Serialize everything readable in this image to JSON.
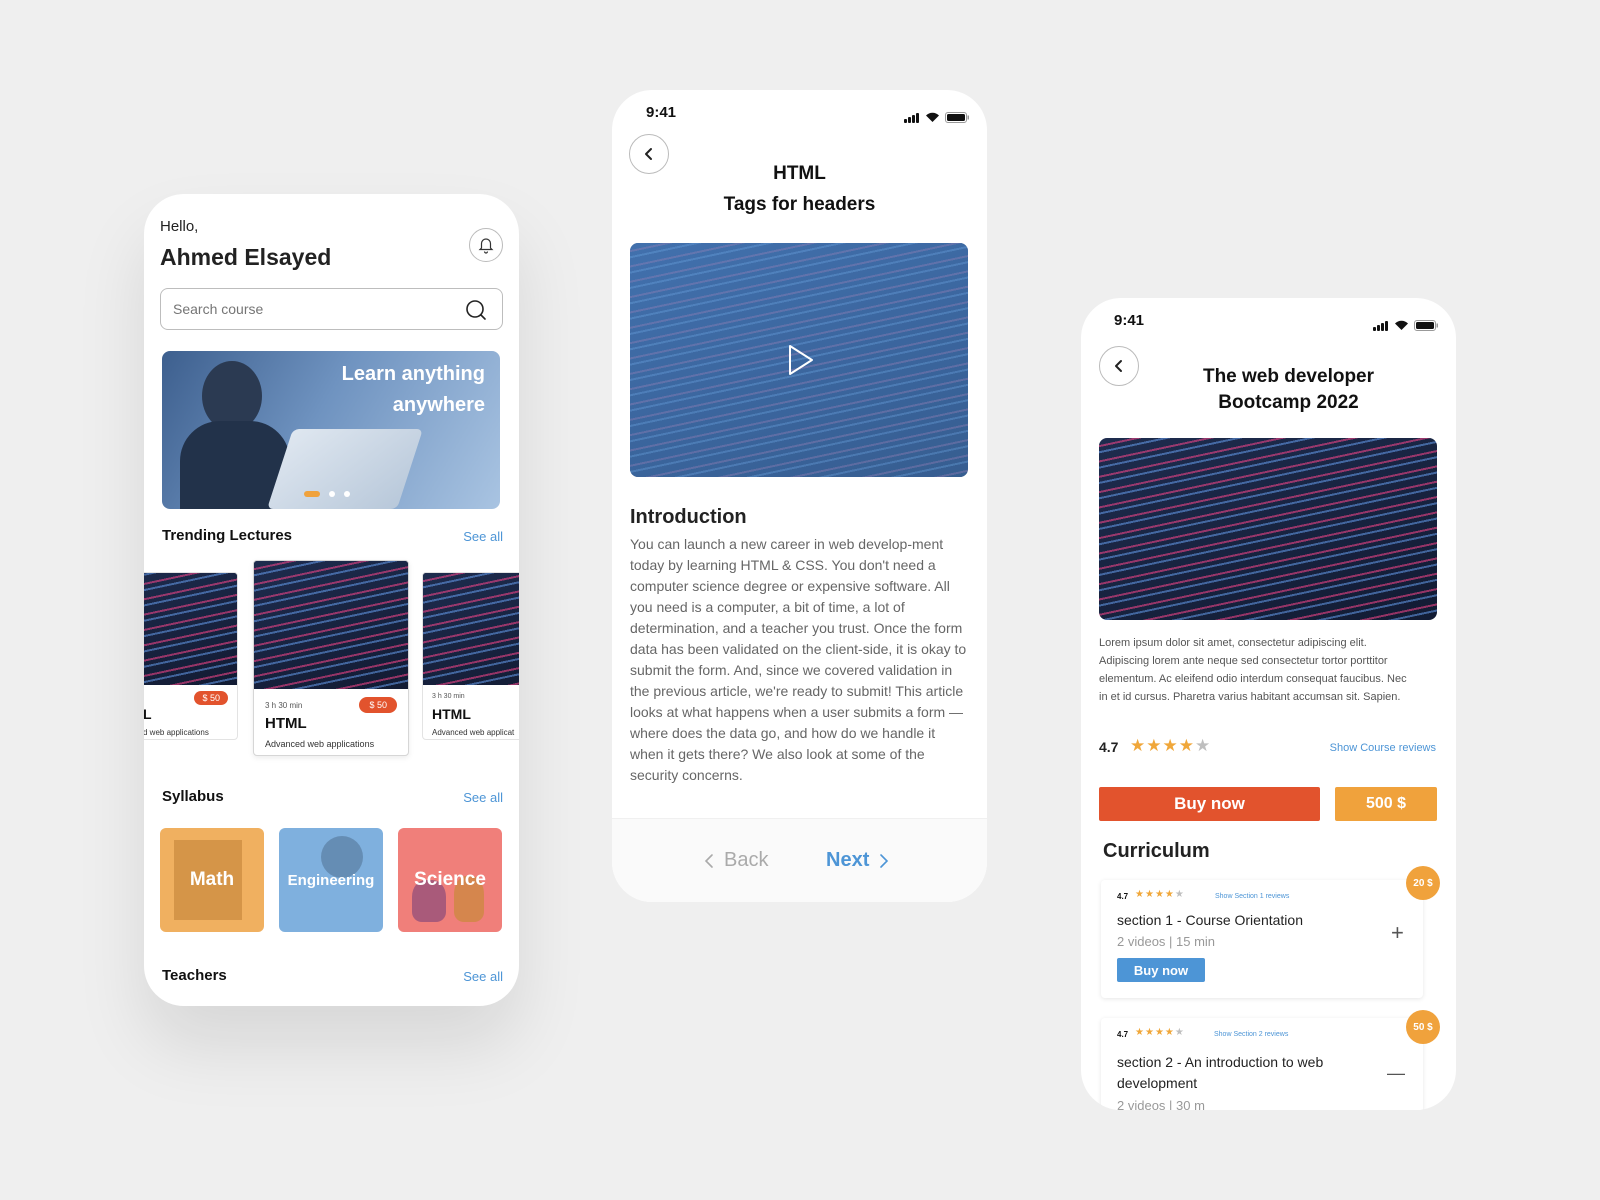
{
  "screen1": {
    "greeting": "Hello,",
    "user_name": "Ahmed Elsayed",
    "icons": {
      "notification": "bell-icon",
      "search": "search-icon"
    },
    "search": {
      "placeholder": "Search course"
    },
    "banner": {
      "line1": "Learn anything",
      "line2": "anywhere",
      "slide_count": 3,
      "active_slide": 1
    },
    "trending": {
      "title": "Trending Lectures",
      "see_all": "See all",
      "cards": [
        {
          "duration": "",
          "price": "$ 50",
          "title": "L",
          "subtitle": "d web applications"
        },
        {
          "duration": "3 h 30 min",
          "price": "$ 50",
          "title": "HTML",
          "subtitle": "Advanced web applications"
        },
        {
          "duration": "3 h 30 min",
          "price": "",
          "title": "HTML",
          "subtitle": "Advanced web applicat"
        }
      ]
    },
    "syllabus": {
      "title": "Syllabus",
      "see_all": "See all",
      "items": [
        {
          "label": "Math",
          "color": "#f0b060"
        },
        {
          "label": "Engineering",
          "color": "#7fb0de"
        },
        {
          "label": "Science",
          "color": "#f07f7a"
        }
      ]
    },
    "teachers": {
      "title": "Teachers",
      "see_all": "See all"
    }
  },
  "screen2": {
    "time": "9:41",
    "title_line1": "HTML",
    "title_line2": "Tags for headers",
    "icons": {
      "back": "chevron-left-icon",
      "play": "play-icon"
    },
    "intro_heading": "Introduction",
    "intro_text": "You can launch a new career in web develop-ment today by learning HTML & CSS. You don't need a computer science degree or expensive software. All you need is a computer, a bit of time, a lot of determination, and a teacher you trust. Once the form data has been validated on the client-side, it is okay to submit the form. And, since we covered validation in the previous article, we're ready to submit! This article looks at what happens when a user submits a form — where does the data go, and how do we handle it when it gets there? We also look at some of the security concerns.",
    "back_label": "Back",
    "next_label": "Next"
  },
  "screen3": {
    "time": "9:41",
    "title_line1": "The web developer",
    "title_line2": "Bootcamp 2022",
    "description": "Lorem ipsum dolor sit amet, consectetur adipiscing elit. Adipiscing lorem ante neque sed consectetur tortor porttitor elementum. Ac eleifend odio interdum consequat faucibus. Nec in et id cursus. Pharetra varius habitant accumsan sit. Sapien.",
    "rating": "4.7",
    "stars": 4,
    "reviews_link": "Show Course reviews",
    "buy_label": "Buy now",
    "price": "500 $",
    "curriculum_title": "Curriculum",
    "colors": {
      "buy": "#e2532d",
      "price": "#f0a23c",
      "accent": "#4d95d6"
    },
    "sections": [
      {
        "rating": "4.7",
        "reviews": "Show Section 1 reviews",
        "title": "section 1 - Course Orientation",
        "meta": "2 videos | 15 min",
        "buy_label": "Buy now",
        "price": "20 $",
        "toggle": "+"
      },
      {
        "rating": "4.7",
        "reviews": "Show Section 2 reviews",
        "title": "section 2 - An introduction to web development",
        "meta": "2 videos | 30 m",
        "price": "50 $",
        "toggle": "—"
      }
    ]
  }
}
